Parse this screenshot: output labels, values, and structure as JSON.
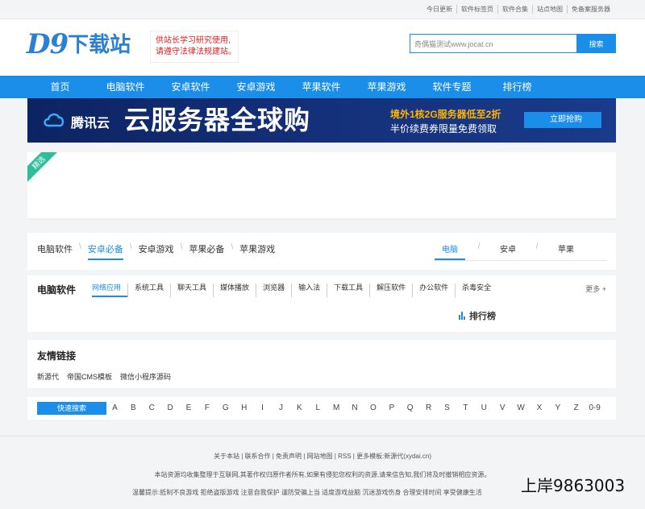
{
  "topbar": {
    "links": [
      "今日更新",
      "软件标签页",
      "软件合集",
      "站点地图",
      "免备案服务器"
    ]
  },
  "header": {
    "logo_latin": "D9",
    "logo_cn": "下载站",
    "notice_line1": "供站长学习研究使用,",
    "notice_line2": "请遵守法律法规建站。",
    "search_value": "奇偶猫测试www.jocat.cn",
    "search_button": "搜索"
  },
  "nav": {
    "items": [
      "首页",
      "电脑软件",
      "安卓软件",
      "安卓游戏",
      "苹果软件",
      "苹果游戏",
      "软件专题",
      "排行榜"
    ]
  },
  "banner": {
    "brand": "腾讯云",
    "headline": "云服务器全球购",
    "line1": "境外1核2G服务器低至2折",
    "line2": "半价续费券限量免费领取",
    "cta": "立即抢购"
  },
  "featured": {
    "ribbon": "精选"
  },
  "section_tabs": {
    "left": [
      "电脑软件",
      "安卓必备",
      "安卓游戏",
      "苹果必备",
      "苹果游戏"
    ],
    "right": [
      "电脑",
      "安卓",
      "苹果"
    ]
  },
  "software": {
    "title": "电脑软件",
    "categories": [
      "网络应用",
      "系统工具",
      "聊天工具",
      "媒体播放",
      "浏览器",
      "输入法",
      "下载工具",
      "解压软件",
      "办公软件",
      "杀毒安全"
    ],
    "more": "更多 +",
    "rank_title": "排行榜"
  },
  "friends": {
    "title": "友情链接",
    "links": [
      "新源代",
      "帝国CMS模板",
      "微信小程序源码"
    ]
  },
  "quick": {
    "button": "快速搜索",
    "letters": [
      "A",
      "B",
      "C",
      "D",
      "E",
      "F",
      "G",
      "H",
      "I",
      "J",
      "K",
      "L",
      "M",
      "N",
      "O",
      "P",
      "Q",
      "R",
      "S",
      "T",
      "U",
      "V",
      "W",
      "X",
      "Y",
      "Z",
      "0-9"
    ]
  },
  "footer": {
    "line1": "关于本站 | 联系合作 | 免责声明 | 网站地图 | RSS | 更多模板:新源代(xydai.cn)",
    "line2": "本站资源均收集整理于互联网,其著作权归原作者所有,如果有侵犯您权利的资源,请来信告知,我们将及时撤销相应资源。",
    "line3": "温馨提示:抵制不良游戏 拒绝盗版游戏 注意自我保护 谨防受骗上当 适度游戏益脑 沉迷游戏伤身 合理安排时间 享受健康生活"
  },
  "watermark": "上岸9863003",
  "colors": {
    "primary": "#1a8ee8",
    "notice": "#e02020",
    "ribbon": "#2dbf9a",
    "banner_accent": "#ffb400"
  }
}
